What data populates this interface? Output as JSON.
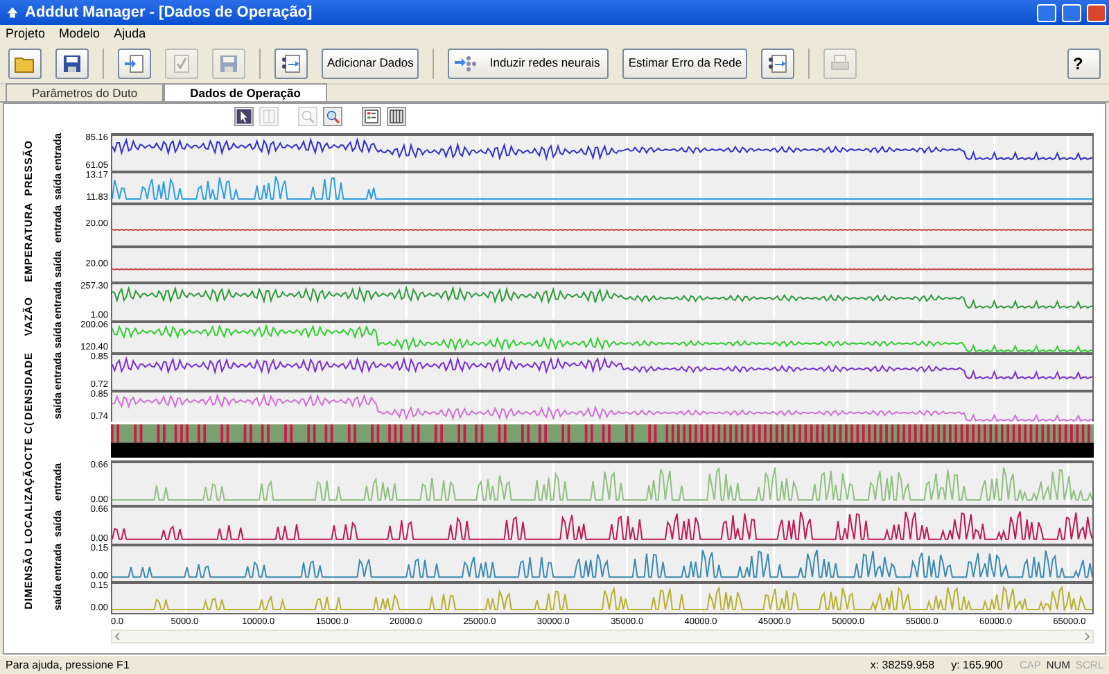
{
  "window": {
    "title": "Adddut Manager - [Dados de Operação]"
  },
  "menu": [
    "Projeto",
    "Modelo",
    "Ajuda"
  ],
  "toolbar": [
    {
      "kind": "folder",
      "disabled": false
    },
    {
      "kind": "disk",
      "disabled": false
    },
    {
      "kind": "separator"
    },
    {
      "kind": "import",
      "disabled": false
    },
    {
      "kind": "check",
      "disabled": true
    },
    {
      "kind": "disk",
      "disabled": true
    },
    {
      "kind": "separator"
    },
    {
      "kind": "config",
      "disabled": false
    },
    {
      "kind": "text",
      "label": "Adicionar Dados",
      "disabled": false
    },
    {
      "kind": "separator"
    },
    {
      "kind": "network",
      "label": "Induzir redes neurais",
      "disabled": false
    },
    {
      "kind": "text",
      "label": "Estimar Erro da Rede",
      "disabled": false
    },
    {
      "kind": "config",
      "disabled": false
    },
    {
      "kind": "separator"
    },
    {
      "kind": "printer",
      "disabled": true
    },
    {
      "kind": "help",
      "label": "?",
      "disabled": false
    }
  ],
  "tabs": [
    {
      "label": "Parâmetros do Duto",
      "selected": false
    },
    {
      "label": "Dados de Operação",
      "selected": true
    }
  ],
  "chart_toolbar": [
    [
      {
        "kind": "cursor",
        "disabled": false
      },
      {
        "kind": "columns",
        "disabled": true
      }
    ],
    [
      {
        "kind": "zoomarea",
        "disabled": true
      },
      {
        "kind": "zoom",
        "disabled": false
      }
    ],
    [
      {
        "kind": "legend",
        "disabled": false
      },
      {
        "kind": "grid",
        "disabled": false
      }
    ]
  ],
  "groups": [
    {
      "label": "PRESSÃO",
      "strips": [
        {
          "label": "entrada",
          "kind": "wave",
          "color": "#3030c8",
          "values": [
            "85.16",
            "61.05"
          ]
        },
        {
          "label": "saída",
          "kind": "spikes",
          "color": "#2f9ee0",
          "values": [
            "13.17",
            "11.83"
          ]
        }
      ]
    },
    {
      "label": "EMPERATURA",
      "strips": [
        {
          "label": "entrada",
          "kind": "flat",
          "color": "#c04040",
          "values": [
            "20.00"
          ]
        },
        {
          "label": "saída",
          "kind": "flat",
          "color": "#c04040",
          "values": [
            "20.00"
          ]
        }
      ]
    },
    {
      "label": "VAZÃO",
      "strips": [
        {
          "label": "entrada",
          "kind": "wave",
          "color": "#2e9a3a",
          "values": [
            "257.30",
            "1.00"
          ]
        },
        {
          "label": "saída",
          "kind": "wave",
          "color": "#33cc33",
          "values": [
            "200.06",
            "120.40"
          ]
        }
      ]
    },
    {
      "label": "DENSIDADE",
      "strips": [
        {
          "label": "entrada",
          "kind": "wave",
          "color": "#7a2ed0",
          "values": [
            "0.85",
            "0.72"
          ]
        },
        {
          "label": "saída",
          "kind": "wave",
          "color": "#d070d8",
          "values": [
            "0.85",
            "0.74"
          ]
        }
      ]
    },
    {
      "label": "CTE C(",
      "strips": [
        {
          "kind": "events"
        }
      ]
    },
    {
      "label": "LOCALIZAÇÃO",
      "strips": [
        {
          "label": "entrada",
          "kind": "spikes",
          "color": "#90c080",
          "values": [
            "0.66",
            "0.00"
          ]
        },
        {
          "label": "saída",
          "kind": "spikes",
          "color": "#c01850",
          "values": [
            "0.66",
            "0.00"
          ]
        }
      ]
    },
    {
      "label": "DIMENSÃO",
      "strips": [
        {
          "label": "entrada",
          "kind": "spikes",
          "color": "#3a8ab0",
          "values": [
            "0.15",
            "0.00"
          ]
        },
        {
          "label": "saída",
          "kind": "spikes",
          "color": "#b8b030",
          "values": [
            "0.15",
            "0.00"
          ]
        }
      ]
    }
  ],
  "x_axis": {
    "ticks": [
      "0.0",
      "5000.0",
      "10000.0",
      "15000.0",
      "20000.0",
      "25000.0",
      "30000.0",
      "35000.0",
      "40000.0",
      "45000.0",
      "50000.0",
      "55000.0",
      "60000.0",
      "65000.0"
    ]
  },
  "status_bar": {
    "text": "Para ajuda, pressione F1",
    "x": "x: 38259.958",
    "y": "y: 165.900",
    "indicators": [
      {
        "label": "CAP",
        "on": false
      },
      {
        "label": "NUM",
        "on": true
      },
      {
        "label": "SCRL",
        "on": false
      }
    ]
  }
}
